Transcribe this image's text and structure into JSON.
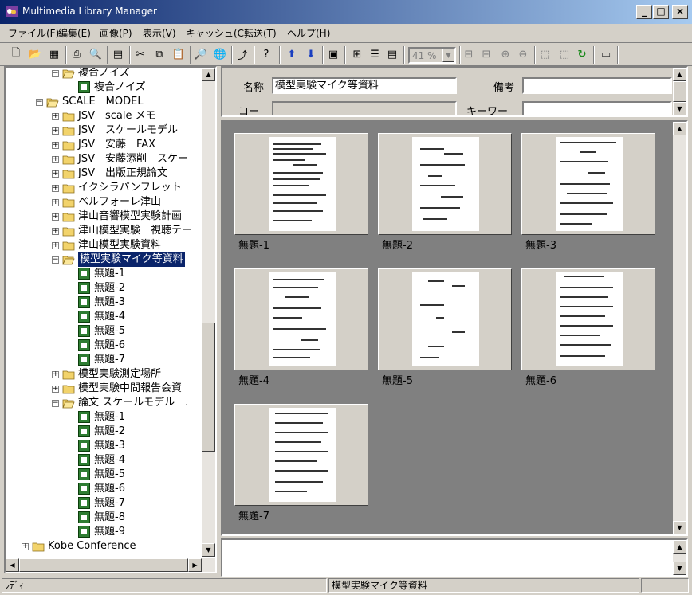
{
  "window": {
    "title": "Multimedia Library Manager"
  },
  "menu": [
    "ファイル(F)",
    "編集(E)",
    "画像(P)",
    "表示(V)",
    "キャッシュ(C)",
    "転送(T)",
    "ヘルプ(H)"
  ],
  "toolbar": {
    "zoom_value": "41 %"
  },
  "tree": {
    "rows": [
      {
        "label": "複合ノイズ",
        "level": 2,
        "type": "folder",
        "expander": "-"
      },
      {
        "label": "複合ノイズ",
        "level": 3,
        "type": "doc",
        "expander": ""
      },
      {
        "label": "SCALE　MODEL",
        "level": 1,
        "type": "folder",
        "expander": "-"
      },
      {
        "label": "JSV　scale メモ",
        "level": 2,
        "type": "folder",
        "expander": "+"
      },
      {
        "label": "JSV　スケールモデル",
        "level": 2,
        "type": "folder",
        "expander": "+"
      },
      {
        "label": "JSV　安藤　FAX",
        "level": 2,
        "type": "folder",
        "expander": "+"
      },
      {
        "label": "JSV　安藤添削　スケー",
        "level": 2,
        "type": "folder",
        "expander": "+"
      },
      {
        "label": "JSV　出版正規論文",
        "level": 2,
        "type": "folder",
        "expander": "+"
      },
      {
        "label": "イクシラパンフレット",
        "level": 2,
        "type": "folder",
        "expander": "+"
      },
      {
        "label": "ベルフォーレ津山",
        "level": 2,
        "type": "folder",
        "expander": "+"
      },
      {
        "label": "津山音響模型実験計画",
        "level": 2,
        "type": "folder",
        "expander": "+"
      },
      {
        "label": "津山模型実験　視聴テー",
        "level": 2,
        "type": "folder",
        "expander": "+"
      },
      {
        "label": "津山模型実験資料",
        "level": 2,
        "type": "folder",
        "expander": "+"
      },
      {
        "label": "模型実験マイク等資料",
        "level": 2,
        "type": "folder",
        "expander": "-",
        "selected": true
      },
      {
        "label": "無題-1",
        "level": 3,
        "type": "doc",
        "expander": ""
      },
      {
        "label": "無題-2",
        "level": 3,
        "type": "doc",
        "expander": ""
      },
      {
        "label": "無題-3",
        "level": 3,
        "type": "doc",
        "expander": ""
      },
      {
        "label": "無題-4",
        "level": 3,
        "type": "doc",
        "expander": ""
      },
      {
        "label": "無題-5",
        "level": 3,
        "type": "doc",
        "expander": ""
      },
      {
        "label": "無題-6",
        "level": 3,
        "type": "doc",
        "expander": ""
      },
      {
        "label": "無題-7",
        "level": 3,
        "type": "doc",
        "expander": ""
      },
      {
        "label": "模型実験測定場所",
        "level": 2,
        "type": "folder",
        "expander": "+"
      },
      {
        "label": "模型実験中間報告会資",
        "level": 2,
        "type": "folder",
        "expander": "+"
      },
      {
        "label": "論文 スケールモデル　.",
        "level": 2,
        "type": "folder",
        "expander": "-"
      },
      {
        "label": "無題-1",
        "level": 3,
        "type": "doc",
        "expander": ""
      },
      {
        "label": "無題-2",
        "level": 3,
        "type": "doc",
        "expander": ""
      },
      {
        "label": "無題-3",
        "level": 3,
        "type": "doc",
        "expander": ""
      },
      {
        "label": "無題-4",
        "level": 3,
        "type": "doc",
        "expander": ""
      },
      {
        "label": "無題-5",
        "level": 3,
        "type": "doc",
        "expander": ""
      },
      {
        "label": "無題-6",
        "level": 3,
        "type": "doc",
        "expander": ""
      },
      {
        "label": "無題-7",
        "level": 3,
        "type": "doc",
        "expander": ""
      },
      {
        "label": "無題-8",
        "level": 3,
        "type": "doc",
        "expander": ""
      },
      {
        "label": "無題-9",
        "level": 3,
        "type": "doc",
        "expander": ""
      },
      {
        "label": "Kobe Conference",
        "level": 0,
        "type": "folder",
        "expander": "+"
      }
    ]
  },
  "form": {
    "name_label": "名称",
    "name_value": "模型実験マイク等資料",
    "remarks_label": "備考",
    "remarks_value": "",
    "code_label": "コー",
    "code_value": "",
    "keyword_label": "キーワー",
    "keyword_value": ""
  },
  "thumbnails": [
    "無題-1",
    "無題-2",
    "無題-3",
    "無題-4",
    "無題-5",
    "無題-6",
    "無題-7"
  ],
  "status": {
    "left": "ﾚﾃﾞｨ",
    "middle": "模型実験マイク等資料"
  }
}
